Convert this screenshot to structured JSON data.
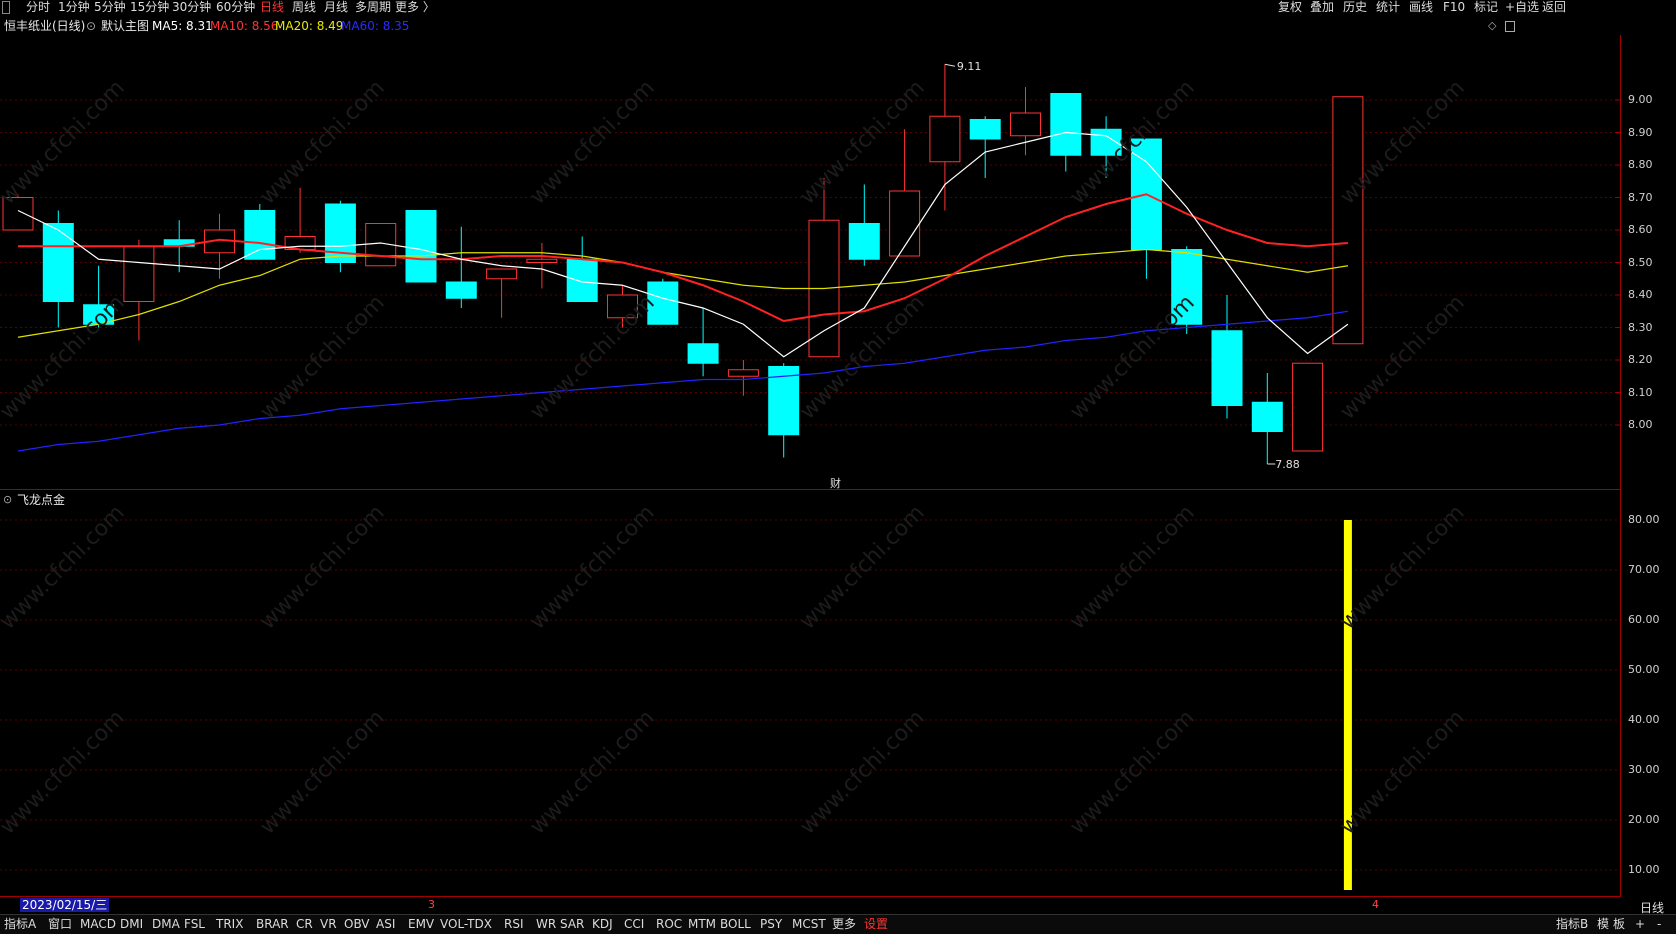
{
  "top_periods": [
    {
      "label": "分时",
      "active": false
    },
    {
      "label": "1分钟",
      "active": false
    },
    {
      "label": "5分钟",
      "active": false
    },
    {
      "label": "15分钟",
      "active": false
    },
    {
      "label": "30分钟",
      "active": false
    },
    {
      "label": "60分钟",
      "active": false
    },
    {
      "label": "日线",
      "active": true
    },
    {
      "label": "周线",
      "active": false
    },
    {
      "label": "月线",
      "active": false
    },
    {
      "label": "多周期",
      "active": false
    },
    {
      "label": "更多 〉",
      "active": false
    }
  ],
  "top_right_buttons": [
    "复权",
    "叠加",
    "历史",
    "统计",
    "画线",
    "F10",
    "标记",
    "+自选",
    "返回"
  ],
  "info": {
    "stock_name": "恒丰纸业(日线)",
    "main_chart": "默认主图",
    "ma5": "MA5: 8.31",
    "ma10": "MA10: 8.56",
    "ma20": "MA20: 8.49",
    "ma60": "MA60: 8.35"
  },
  "colors": {
    "bull": "#ff3333",
    "bear": "#00ffff",
    "ma5": "#ffffff",
    "ma10": "#ff2222",
    "ma20": "#e0e000",
    "ma60": "#2222ff",
    "indicator_bar": "#ffff00",
    "border": "#a00000"
  },
  "main_axis_labels": [
    "9.00",
    "8.90",
    "8.80",
    "8.70",
    "8.60",
    "8.50",
    "8.40",
    "8.30",
    "8.20",
    "8.10",
    "8.00"
  ],
  "high_marker": "9.11",
  "low_marker": "7.88",
  "event_marker": "财",
  "sub_panel_title": "飞龙点金",
  "sub_axis_labels": [
    "80.00",
    "70.00",
    "60.00",
    "50.00",
    "40.00",
    "30.00",
    "20.00",
    "10.00"
  ],
  "watermark": "www.cfchi.com",
  "cursor_date": "2023/02/15/三",
  "month_marks": [
    "3",
    "4"
  ],
  "period_label": "日线",
  "chart_data": {
    "type": "candlestick",
    "ylim": [
      7.8,
      9.2
    ],
    "candles": [
      {
        "o": 8.6,
        "h": 8.71,
        "l": 8.6,
        "c": 8.7
      },
      {
        "o": 8.62,
        "h": 8.66,
        "l": 8.3,
        "c": 8.38
      },
      {
        "o": 8.37,
        "h": 8.49,
        "l": 8.3,
        "c": 8.31
      },
      {
        "o": 8.38,
        "h": 8.57,
        "l": 8.26,
        "c": 8.55
      },
      {
        "o": 8.57,
        "h": 8.63,
        "l": 8.47,
        "c": 8.55
      },
      {
        "o": 8.53,
        "h": 8.65,
        "l": 8.45,
        "c": 8.6
      },
      {
        "o": 8.66,
        "h": 8.68,
        "l": 8.51,
        "c": 8.51
      },
      {
        "o": 8.54,
        "h": 8.73,
        "l": 8.53,
        "c": 8.58
      },
      {
        "o": 8.68,
        "h": 8.69,
        "l": 8.47,
        "c": 8.5
      },
      {
        "o": 8.49,
        "h": 8.62,
        "l": 8.49,
        "c": 8.62
      },
      {
        "o": 8.66,
        "h": 8.66,
        "l": 8.44,
        "c": 8.44
      },
      {
        "o": 8.44,
        "h": 8.61,
        "l": 8.36,
        "c": 8.39
      },
      {
        "o": 8.45,
        "h": 8.48,
        "l": 8.33,
        "c": 8.48
      },
      {
        "o": 8.5,
        "h": 8.56,
        "l": 8.42,
        "c": 8.51
      },
      {
        "o": 8.51,
        "h": 8.58,
        "l": 8.45,
        "c": 8.38
      },
      {
        "o": 8.33,
        "h": 8.43,
        "l": 8.3,
        "c": 8.4
      },
      {
        "o": 8.44,
        "h": 8.45,
        "l": 8.31,
        "c": 8.31
      },
      {
        "o": 8.25,
        "h": 8.36,
        "l": 8.15,
        "c": 8.19
      },
      {
        "o": 8.15,
        "h": 8.2,
        "l": 8.09,
        "c": 8.17
      },
      {
        "o": 8.18,
        "h": 8.19,
        "l": 7.9,
        "c": 7.97
      },
      {
        "o": 8.21,
        "h": 8.76,
        "l": 8.21,
        "c": 8.63
      },
      {
        "o": 8.62,
        "h": 8.74,
        "l": 8.49,
        "c": 8.51
      },
      {
        "o": 8.52,
        "h": 8.91,
        "l": 8.52,
        "c": 8.72
      },
      {
        "o": 8.81,
        "h": 9.11,
        "l": 8.66,
        "c": 8.95
      },
      {
        "o": 8.94,
        "h": 8.95,
        "l": 8.76,
        "c": 8.88
      },
      {
        "o": 8.89,
        "h": 9.04,
        "l": 8.83,
        "c": 8.96
      },
      {
        "o": 9.02,
        "h": 9.02,
        "l": 8.78,
        "c": 8.83
      },
      {
        "o": 8.91,
        "h": 8.95,
        "l": 8.76,
        "c": 8.83
      },
      {
        "o": 8.88,
        "h": 8.88,
        "l": 8.45,
        "c": 8.54
      },
      {
        "o": 8.54,
        "h": 8.55,
        "l": 8.28,
        "c": 8.31
      },
      {
        "o": 8.29,
        "h": 8.4,
        "l": 8.02,
        "c": 8.06
      },
      {
        "o": 8.07,
        "h": 8.16,
        "l": 7.88,
        "c": 7.98
      },
      {
        "o": 7.92,
        "h": 8.19,
        "l": 7.92,
        "c": 8.19
      },
      {
        "o": 8.25,
        "h": 9.01,
        "l": 8.25,
        "c": 9.01
      }
    ],
    "ma5": [
      8.66,
      8.6,
      8.51,
      8.5,
      8.49,
      8.48,
      8.54,
      8.55,
      8.55,
      8.56,
      8.54,
      8.51,
      8.49,
      8.48,
      8.44,
      8.43,
      8.39,
      8.36,
      8.31,
      8.21,
      8.29,
      8.36,
      8.55,
      8.74,
      8.84,
      8.87,
      8.9,
      8.89,
      8.81,
      8.67,
      8.5,
      8.33,
      8.22,
      8.31
    ],
    "ma10": [
      8.55,
      8.55,
      8.55,
      8.55,
      8.55,
      8.57,
      8.56,
      8.54,
      8.53,
      8.52,
      8.51,
      8.51,
      8.52,
      8.52,
      8.51,
      8.5,
      8.47,
      8.43,
      8.38,
      8.32,
      8.34,
      8.35,
      8.39,
      8.45,
      8.52,
      8.58,
      8.64,
      8.68,
      8.71,
      8.65,
      8.6,
      8.56,
      8.55,
      8.56
    ],
    "ma20": [
      8.27,
      8.29,
      8.31,
      8.34,
      8.38,
      8.43,
      8.46,
      8.51,
      8.52,
      8.52,
      8.52,
      8.53,
      8.53,
      8.53,
      8.52,
      8.5,
      8.47,
      8.45,
      8.43,
      8.42,
      8.42,
      8.43,
      8.44,
      8.46,
      8.48,
      8.5,
      8.52,
      8.53,
      8.54,
      8.53,
      8.51,
      8.49,
      8.47,
      8.49
    ],
    "ma60": [
      7.92,
      7.94,
      7.95,
      7.97,
      7.99,
      8.0,
      8.02,
      8.03,
      8.05,
      8.06,
      8.07,
      8.08,
      8.09,
      8.1,
      8.11,
      8.12,
      8.13,
      8.14,
      8.14,
      8.15,
      8.16,
      8.18,
      8.19,
      8.21,
      8.23,
      8.24,
      8.26,
      8.27,
      8.29,
      8.3,
      8.31,
      8.32,
      8.33,
      8.35
    ],
    "sub_ylim": [
      5,
      86
    ],
    "sub_bars": [
      {
        "index": 33,
        "value": 80
      }
    ]
  },
  "bottom_tabs": [
    {
      "label": "指标A",
      "hl": false
    },
    {
      "label": "窗口",
      "hl": false
    },
    {
      "label": "MACD",
      "hl": false
    },
    {
      "label": "DMI",
      "hl": false
    },
    {
      "label": "DMA",
      "hl": false
    },
    {
      "label": "FSL",
      "hl": false
    },
    {
      "label": "TRIX",
      "hl": false
    },
    {
      "label": "BRAR",
      "hl": false
    },
    {
      "label": "CR",
      "hl": false
    },
    {
      "label": "VR",
      "hl": false
    },
    {
      "label": "OBV",
      "hl": false
    },
    {
      "label": "ASI",
      "hl": false
    },
    {
      "label": "EMV",
      "hl": false
    },
    {
      "label": "VOL-TDX",
      "hl": false
    },
    {
      "label": "RSI",
      "hl": false
    },
    {
      "label": "WR",
      "hl": false
    },
    {
      "label": "SAR",
      "hl": false
    },
    {
      "label": "KDJ",
      "hl": false
    },
    {
      "label": "CCI",
      "hl": false
    },
    {
      "label": "ROC",
      "hl": false
    },
    {
      "label": "MTM",
      "hl": false
    },
    {
      "label": "BOLL",
      "hl": false
    },
    {
      "label": "PSY",
      "hl": false
    },
    {
      "label": "MCST",
      "hl": false
    },
    {
      "label": "更多",
      "hl": false
    },
    {
      "label": "设置",
      "hl": true
    }
  ],
  "bottom_right": [
    "指标B",
    "模",
    "板",
    "+",
    "-"
  ]
}
